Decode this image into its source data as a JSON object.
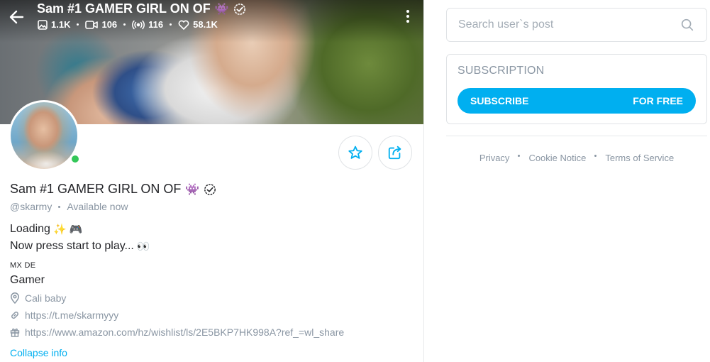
{
  "cover": {
    "title": "Sam #1 GAMER GIRL ON OF",
    "stats": {
      "photos": "1.1K",
      "videos": "106",
      "streams": "116",
      "likes": "58.1K"
    }
  },
  "profile": {
    "name": "Sam #1 GAMER GIRL ON OF",
    "handle": "@skarmy",
    "status": "Available now",
    "bio": {
      "line1": "Loading",
      "line2": "Now press start to play...",
      "tag": "MX DE",
      "line3": "Gamer"
    },
    "location": "Cali baby",
    "link": "https://t.me/skarmyyy",
    "wishlist": "https://www.amazon.com/hz/wishlist/ls/2E5BKP7HK998A?ref_=wl_share",
    "collapse_label": "Collapse info"
  },
  "search": {
    "placeholder": "Search user`s post"
  },
  "subscription": {
    "title": "SUBSCRIPTION",
    "button_label": "SUBSCRIBE",
    "price_label": "FOR FREE"
  },
  "footer": {
    "links": [
      "Privacy",
      "Cookie Notice",
      "Terms of Service"
    ]
  },
  "colors": {
    "accent": "#00aff0",
    "online": "#34c759",
    "muted_text": "#8a96a3"
  }
}
